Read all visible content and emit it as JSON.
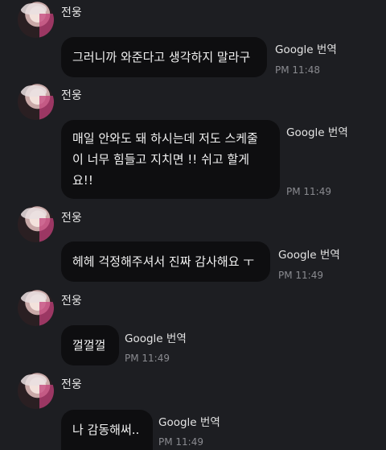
{
  "messages": [
    {
      "sender": "전웅",
      "text": "그러니까 와준다고 생각하지 말라구",
      "translate_label": "Google 번역",
      "time": "PM 11:48"
    },
    {
      "sender": "전웅",
      "text": "매일 안와도 돼 하시는데 저도 스케줄이 너무 힘들고 지치면 !! 쉬고 할게요!!",
      "translate_label": "Google 번역",
      "time": "PM 11:49"
    },
    {
      "sender": "전웅",
      "text": "헤헤 걱정해주셔서 진짜 감사해요 ㅜ",
      "translate_label": "Google 번역",
      "time": "PM 11:49"
    },
    {
      "sender": "전웅",
      "text": "껄껄껄",
      "translate_label": "Google 번역",
      "time": "PM 11:49"
    },
    {
      "sender": "전웅",
      "text": "나 감동해써..",
      "translate_label": "Google 번역",
      "time": "PM 11:49"
    }
  ]
}
